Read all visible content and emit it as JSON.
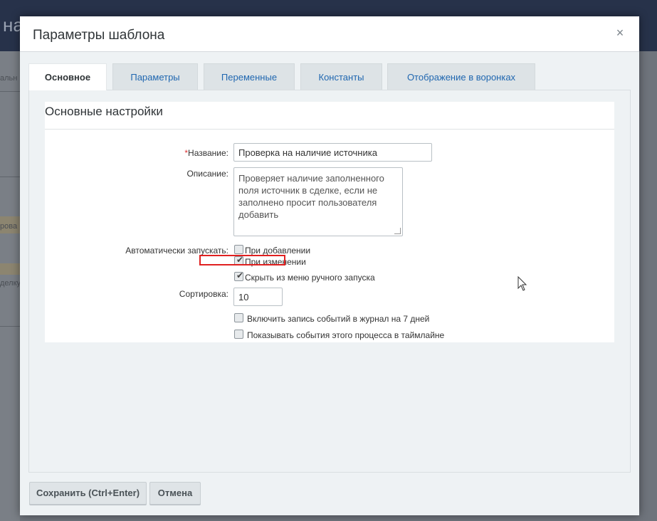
{
  "background": {
    "title_fragment": "на",
    "side_fragments": [
      "альн",
      "рова",
      "делку"
    ]
  },
  "dialog": {
    "title": "Параметры шаблона",
    "close_glyph": "×",
    "tabs": [
      {
        "label": "Основное",
        "active": true
      },
      {
        "label": "Параметры",
        "active": false
      },
      {
        "label": "Переменные",
        "active": false
      },
      {
        "label": "Константы",
        "active": false
      },
      {
        "label": "Отображение в воронках",
        "active": false
      }
    ],
    "section_title": "Основные настройки",
    "form": {
      "name_required_mark": "*",
      "name_label": "Название:",
      "name_value": "Проверка на наличие источника",
      "description_label": "Описание:",
      "description_value": "Проверяет наличие заполненного поля источник в сделке, если не заполнено просит пользователя добавить",
      "autorun_label": "Автоматически запускать:",
      "on_add_label": "При добавлении",
      "on_add_checked": false,
      "on_change_label": "При изменении",
      "on_change_checked": true,
      "hide_manual_label": "Скрыть из меню ручного запуска",
      "hide_manual_checked": true,
      "sort_label": "Сортировка:",
      "sort_value": "10",
      "log_events_label": "Включить запись событий в журнал на 7 дней",
      "log_events_checked": false,
      "timeline_label": "Показывать события этого процесса в таймлайне",
      "timeline_checked": false
    },
    "buttons": {
      "save": "Сохранить (Ctrl+Enter)",
      "cancel": "Отмена"
    }
  },
  "colors": {
    "highlight": "#e02020",
    "tab_link": "#2067b0",
    "header_bg": "#27324a"
  },
  "icons": {
    "close": "close-icon",
    "check": "check-icon",
    "cursor": "mouse-pointer-icon"
  }
}
